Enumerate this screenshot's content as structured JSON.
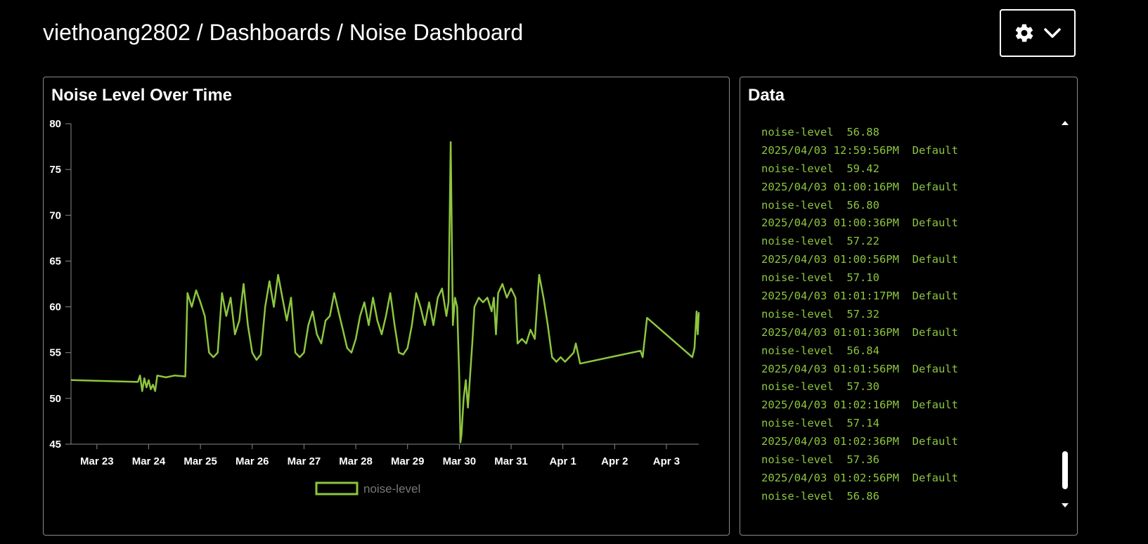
{
  "header": {
    "user": "viethoang2802",
    "sep1": " / ",
    "section": "Dashboards",
    "sep2": " / ",
    "dashboard": "Noise Dashboard"
  },
  "settings_button": {
    "icon": "gear-icon",
    "caret": "chevron-down-icon"
  },
  "chart_panel": {
    "title": "Noise Level Over Time"
  },
  "data_panel": {
    "title": "Data",
    "lines": [
      "noise-level  56.88",
      "2025/04/03 12:59:56PM  Default",
      "noise-level  59.42",
      "2025/04/03 01:00:16PM  Default",
      "noise-level  56.80",
      "2025/04/03 01:00:36PM  Default",
      "noise-level  57.22",
      "2025/04/03 01:00:56PM  Default",
      "noise-level  57.10",
      "2025/04/03 01:01:17PM  Default",
      "noise-level  57.32",
      "2025/04/03 01:01:36PM  Default",
      "noise-level  56.84",
      "2025/04/03 01:01:56PM  Default",
      "noise-level  57.30",
      "2025/04/03 01:02:16PM  Default",
      "noise-level  57.14",
      "2025/04/03 01:02:36PM  Default",
      "noise-level  57.36",
      "2025/04/03 01:02:56PM  Default",
      "noise-level  56.86"
    ]
  },
  "colors": {
    "series": "#8dc63f",
    "axis": "#888888",
    "background": "#000000",
    "text": "#ffffff"
  },
  "chart_data": {
    "type": "line",
    "title": "Noise Level Over Time",
    "xlabel": "",
    "ylabel": "",
    "ylim": [
      45,
      80
    ],
    "yticks": [
      45,
      50,
      55,
      60,
      65,
      70,
      75,
      80
    ],
    "xlim": [
      "2025-03-22T12:00",
      "2025-04-03T15:00"
    ],
    "xticks": [
      {
        "label": "Mar 23",
        "date": "2025-03-23T00:00"
      },
      {
        "label": "Mar 24",
        "date": "2025-03-24T00:00"
      },
      {
        "label": "Mar 25",
        "date": "2025-03-25T00:00"
      },
      {
        "label": "Mar 26",
        "date": "2025-03-26T00:00"
      },
      {
        "label": "Mar 27",
        "date": "2025-03-27T00:00"
      },
      {
        "label": "Mar 28",
        "date": "2025-03-28T00:00"
      },
      {
        "label": "Mar 29",
        "date": "2025-03-29T00:00"
      },
      {
        "label": "Mar 30",
        "date": "2025-03-30T00:00"
      },
      {
        "label": "Mar 31",
        "date": "2025-03-31T00:00"
      },
      {
        "label": "Apr 1",
        "date": "2025-04-01T00:00"
      },
      {
        "label": "Apr 2",
        "date": "2025-04-02T00:00"
      },
      {
        "label": "Apr 3",
        "date": "2025-04-03T00:00"
      }
    ],
    "grid": false,
    "legend": "bottom-center",
    "series": [
      {
        "name": "noise-level",
        "color": "#8dc63f",
        "points": [
          [
            "2025-03-22T12:00",
            52.0
          ],
          [
            "2025-03-23T19:00",
            51.8
          ],
          [
            "2025-03-23T20:00",
            52.5
          ],
          [
            "2025-03-23T21:00",
            50.8
          ],
          [
            "2025-03-23T22:00",
            52.2
          ],
          [
            "2025-03-23T23:00",
            51.2
          ],
          [
            "2025-03-24T00:00",
            52.0
          ],
          [
            "2025-03-24T01:00",
            51.0
          ],
          [
            "2025-03-24T02:00",
            51.5
          ],
          [
            "2025-03-24T03:00",
            50.8
          ],
          [
            "2025-03-24T04:00",
            52.5
          ],
          [
            "2025-03-24T08:00",
            52.3
          ],
          [
            "2025-03-24T12:00",
            52.5
          ],
          [
            "2025-03-24T17:00",
            52.4
          ],
          [
            "2025-03-24T18:00",
            61.5
          ],
          [
            "2025-03-24T20:00",
            60.0
          ],
          [
            "2025-03-24T22:00",
            61.8
          ],
          [
            "2025-03-25T00:00",
            60.5
          ],
          [
            "2025-03-25T02:00",
            59.0
          ],
          [
            "2025-03-25T04:00",
            55.0
          ],
          [
            "2025-03-25T06:00",
            54.5
          ],
          [
            "2025-03-25T08:00",
            55.0
          ],
          [
            "2025-03-25T10:00",
            61.5
          ],
          [
            "2025-03-25T12:00",
            59.0
          ],
          [
            "2025-03-25T14:00",
            61.0
          ],
          [
            "2025-03-25T16:00",
            57.0
          ],
          [
            "2025-03-25T18:00",
            58.5
          ],
          [
            "2025-03-25T20:00",
            62.5
          ],
          [
            "2025-03-25T22:00",
            58.0
          ],
          [
            "2025-03-26T00:00",
            55.0
          ],
          [
            "2025-03-26T02:00",
            54.2
          ],
          [
            "2025-03-26T04:00",
            54.8
          ],
          [
            "2025-03-26T06:00",
            60.0
          ],
          [
            "2025-03-26T08:00",
            62.8
          ],
          [
            "2025-03-26T10:00",
            60.0
          ],
          [
            "2025-03-26T12:00",
            63.5
          ],
          [
            "2025-03-26T14:00",
            61.0
          ],
          [
            "2025-03-26T16:00",
            58.5
          ],
          [
            "2025-03-26T18:00",
            61.0
          ],
          [
            "2025-03-26T20:00",
            55.0
          ],
          [
            "2025-03-26T22:00",
            54.5
          ],
          [
            "2025-03-27T00:00",
            55.0
          ],
          [
            "2025-03-27T02:00",
            58.0
          ],
          [
            "2025-03-27T04:00",
            59.5
          ],
          [
            "2025-03-27T06:00",
            57.0
          ],
          [
            "2025-03-27T08:00",
            56.0
          ],
          [
            "2025-03-27T10:00",
            58.5
          ],
          [
            "2025-03-27T12:00",
            59.0
          ],
          [
            "2025-03-27T14:00",
            61.5
          ],
          [
            "2025-03-27T16:00",
            59.5
          ],
          [
            "2025-03-27T18:00",
            57.5
          ],
          [
            "2025-03-27T20:00",
            55.5
          ],
          [
            "2025-03-27T22:00",
            55.0
          ],
          [
            "2025-03-28T00:00",
            56.5
          ],
          [
            "2025-03-28T02:00",
            59.0
          ],
          [
            "2025-03-28T04:00",
            60.5
          ],
          [
            "2025-03-28T06:00",
            58.0
          ],
          [
            "2025-03-28T08:00",
            61.0
          ],
          [
            "2025-03-28T10:00",
            58.5
          ],
          [
            "2025-03-28T12:00",
            57.0
          ],
          [
            "2025-03-28T14:00",
            59.0
          ],
          [
            "2025-03-28T16:00",
            61.5
          ],
          [
            "2025-03-28T18:00",
            58.0
          ],
          [
            "2025-03-28T20:00",
            55.0
          ],
          [
            "2025-03-28T22:00",
            54.8
          ],
          [
            "2025-03-29T00:00",
            55.5
          ],
          [
            "2025-03-29T02:00",
            58.0
          ],
          [
            "2025-03-29T04:00",
            61.5
          ],
          [
            "2025-03-29T06:00",
            60.0
          ],
          [
            "2025-03-29T08:00",
            58.0
          ],
          [
            "2025-03-29T10:00",
            60.5
          ],
          [
            "2025-03-29T12:00",
            58.0
          ],
          [
            "2025-03-29T14:00",
            61.0
          ],
          [
            "2025-03-29T16:00",
            62.0
          ],
          [
            "2025-03-29T18:00",
            59.0
          ],
          [
            "2025-03-29T19:00",
            60.5
          ],
          [
            "2025-03-29T20:00",
            78.0
          ],
          [
            "2025-03-29T21:00",
            58.0
          ],
          [
            "2025-03-29T22:00",
            61.0
          ],
          [
            "2025-03-29T23:00",
            60.0
          ],
          [
            "2025-03-30T00:00",
            52.0
          ],
          [
            "2025-03-30T00:30",
            45.2
          ],
          [
            "2025-03-30T01:00",
            46.0
          ],
          [
            "2025-03-30T02:00",
            50.0
          ],
          [
            "2025-03-30T03:00",
            52.0
          ],
          [
            "2025-03-30T04:00",
            49.0
          ],
          [
            "2025-03-30T05:00",
            52.5
          ],
          [
            "2025-03-30T06:00",
            56.0
          ],
          [
            "2025-03-30T07:00",
            60.0
          ],
          [
            "2025-03-30T09:00",
            61.0
          ],
          [
            "2025-03-30T11:00",
            60.5
          ],
          [
            "2025-03-30T13:00",
            61.0
          ],
          [
            "2025-03-30T15:00",
            59.5
          ],
          [
            "2025-03-30T16:00",
            61.0
          ],
          [
            "2025-03-30T17:00",
            57.0
          ],
          [
            "2025-03-30T18:00",
            61.5
          ],
          [
            "2025-03-30T20:00",
            62.5
          ],
          [
            "2025-03-30T22:00",
            61.0
          ],
          [
            "2025-03-31T00:00",
            62.0
          ],
          [
            "2025-03-31T02:00",
            61.0
          ],
          [
            "2025-03-31T03:00",
            56.0
          ],
          [
            "2025-03-31T05:00",
            56.5
          ],
          [
            "2025-03-31T07:00",
            56.0
          ],
          [
            "2025-03-31T09:00",
            57.5
          ],
          [
            "2025-03-31T11:00",
            56.5
          ],
          [
            "2025-03-31T13:00",
            63.5
          ],
          [
            "2025-03-31T15:00",
            61.0
          ],
          [
            "2025-03-31T17:00",
            58.0
          ],
          [
            "2025-03-31T19:00",
            54.5
          ],
          [
            "2025-03-31T21:00",
            54.0
          ],
          [
            "2025-03-31T23:00",
            54.5
          ],
          [
            "2025-04-01T01:00",
            54.0
          ],
          [
            "2025-04-01T03:00",
            54.5
          ],
          [
            "2025-04-01T05:00",
            55.0
          ],
          [
            "2025-04-01T06:00",
            56.0
          ],
          [
            "2025-04-01T08:00",
            53.8
          ],
          [
            "2025-04-02T12:00",
            55.2
          ],
          [
            "2025-04-02T13:00",
            54.5
          ],
          [
            "2025-04-02T15:00",
            58.8
          ],
          [
            "2025-04-03T12:00",
            54.5
          ],
          [
            "2025-04-03T13:00",
            55.5
          ],
          [
            "2025-04-03T14:00",
            59.5
          ],
          [
            "2025-04-03T14:30",
            57.0
          ],
          [
            "2025-04-03T15:00",
            59.4
          ]
        ]
      }
    ]
  }
}
